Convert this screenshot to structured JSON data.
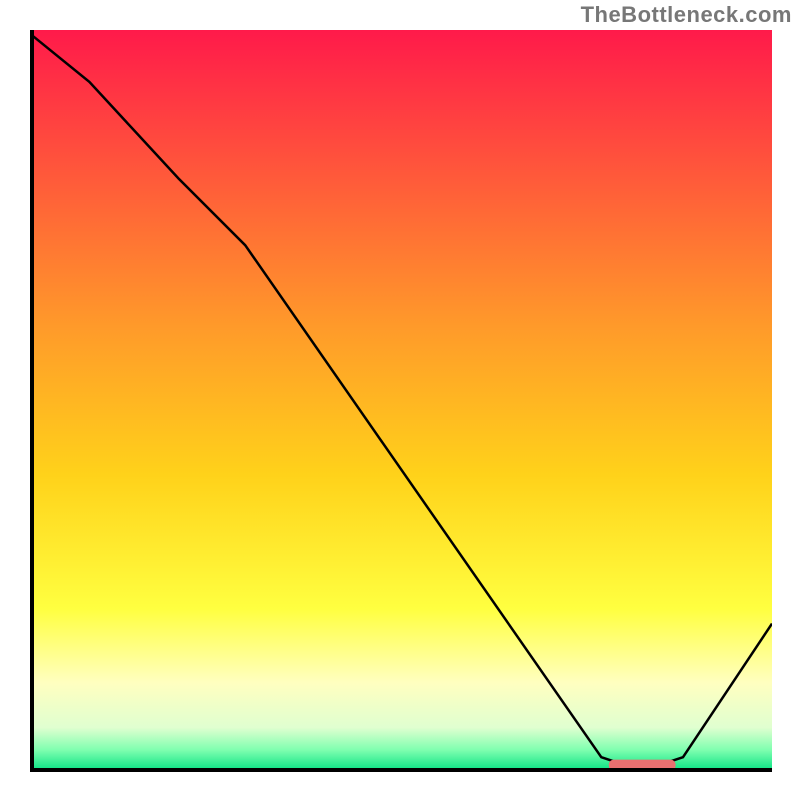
{
  "watermark": "TheBottleneck.com",
  "chart_data": {
    "type": "line",
    "title": "",
    "xlabel": "",
    "ylabel": "",
    "xlim": [
      0,
      100
    ],
    "ylim": [
      0,
      100
    ],
    "background_gradient": {
      "stops": [
        {
          "offset": 0.0,
          "color": "#ff1a4a"
        },
        {
          "offset": 0.2,
          "color": "#ff5a3a"
        },
        {
          "offset": 0.4,
          "color": "#ff9a2a"
        },
        {
          "offset": 0.6,
          "color": "#ffd21a"
        },
        {
          "offset": 0.78,
          "color": "#ffff40"
        },
        {
          "offset": 0.88,
          "color": "#ffffc0"
        },
        {
          "offset": 0.94,
          "color": "#e0ffd0"
        },
        {
          "offset": 0.97,
          "color": "#80ffb0"
        },
        {
          "offset": 1.0,
          "color": "#00e080"
        }
      ]
    },
    "curve": {
      "description": "bottleneck curve",
      "x": [
        0,
        8,
        20,
        29,
        77,
        80,
        85,
        88,
        100
      ],
      "y": [
        99.5,
        93,
        80,
        71,
        2,
        1,
        1,
        2,
        20
      ]
    },
    "optimal_marker": {
      "x_start": 78,
      "x_end": 87,
      "y": 1,
      "color": "#e87070"
    }
  }
}
